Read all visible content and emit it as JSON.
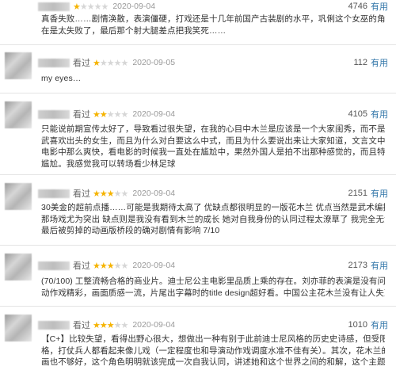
{
  "reviews": [
    {
      "watched": "",
      "rating": 1,
      "date": "2020-09-04",
      "votes": "4746",
      "useful_label": "有用",
      "lines": [
        "真香失败……剧情涣散，表演僵硬，打戏还是十几年前国产古装剧的水平，巩俐这个女巫的角色加得实",
        "在是太失败了，最后那个射大腿差点把我笑死……"
      ]
    },
    {
      "watched": "看过",
      "rating": 1,
      "date": "2020-09-05",
      "votes": "112",
      "useful_label": "有用",
      "lines": [
        "my eyes…"
      ]
    },
    {
      "watched": "看过",
      "rating": 2,
      "date": "2020-09-04",
      "votes": "4105",
      "useful_label": "有用",
      "lines": [
        "只能说前期宣传太好了，导致看过很失望，在我的心目中木兰是应该是一个大家闺秀，而不是从小就习",
        "武喜欢出头的女生，而且为什么对白要这么中式，而且为什么要说出来让大家知道，文言文中体现的是木兰迫不得已才替父出征，而不是像",
        "电影中那么爽快，看电影的时候我一直处在尴尬中，果然外国人是拍不出那种感觉的，而且特效用的很",
        "尴尬。我感觉我可以转场看少林足球"
      ]
    },
    {
      "watched": "看过",
      "rating": 3,
      "date": "2020-09-04",
      "votes": "2151",
      "useful_label": "有用",
      "lines": [
        "30美金的超前点播……可能是我期待太高了 优缺点都很明显的一版花木兰 优点当然是武术编排和画面 雪崩",
        "那场戏尤为突出 缺点则是我没有看到木兰的成长 她对自我身份的认同过程太潦草了 我完全无法和她共情",
        "最后被剪掉的动画版桥段的确对剧情有影响 7/10"
      ]
    },
    {
      "watched": "看过",
      "rating": 3,
      "date": "2020-09-04",
      "votes": "2173",
      "useful_label": "有用",
      "lines": [
        "(70/100) 工整流畅合格的商业片。迪士尼公主电影里品质上乘的存在。刘亦菲的表演是没有问题的，",
        "动作戏精彩，画面质感一流，片尾出字幕时的title design超好看。中国公主花木兰没有让人失望。"
      ]
    },
    {
      "watched": "看过",
      "rating": 3,
      "date": "2020-09-04",
      "votes": "1010",
      "useful_label": "有用",
      "lines": [
        "【C+】比较失望，看得出野心很大，想做出一种有别于此前迪士尼风格的历史史诗感，但受限于童话风",
        "格，打仗兵人都看起来像儿戏（一定程度也和导演动作戏调度水准不佳有关）。其次，花木兰的人物刻",
        "画也不够好，这个角色明明就该完成一次自我认同，讲述她和这个世界之间的和解，这个主题在这里"
      ]
    }
  ]
}
